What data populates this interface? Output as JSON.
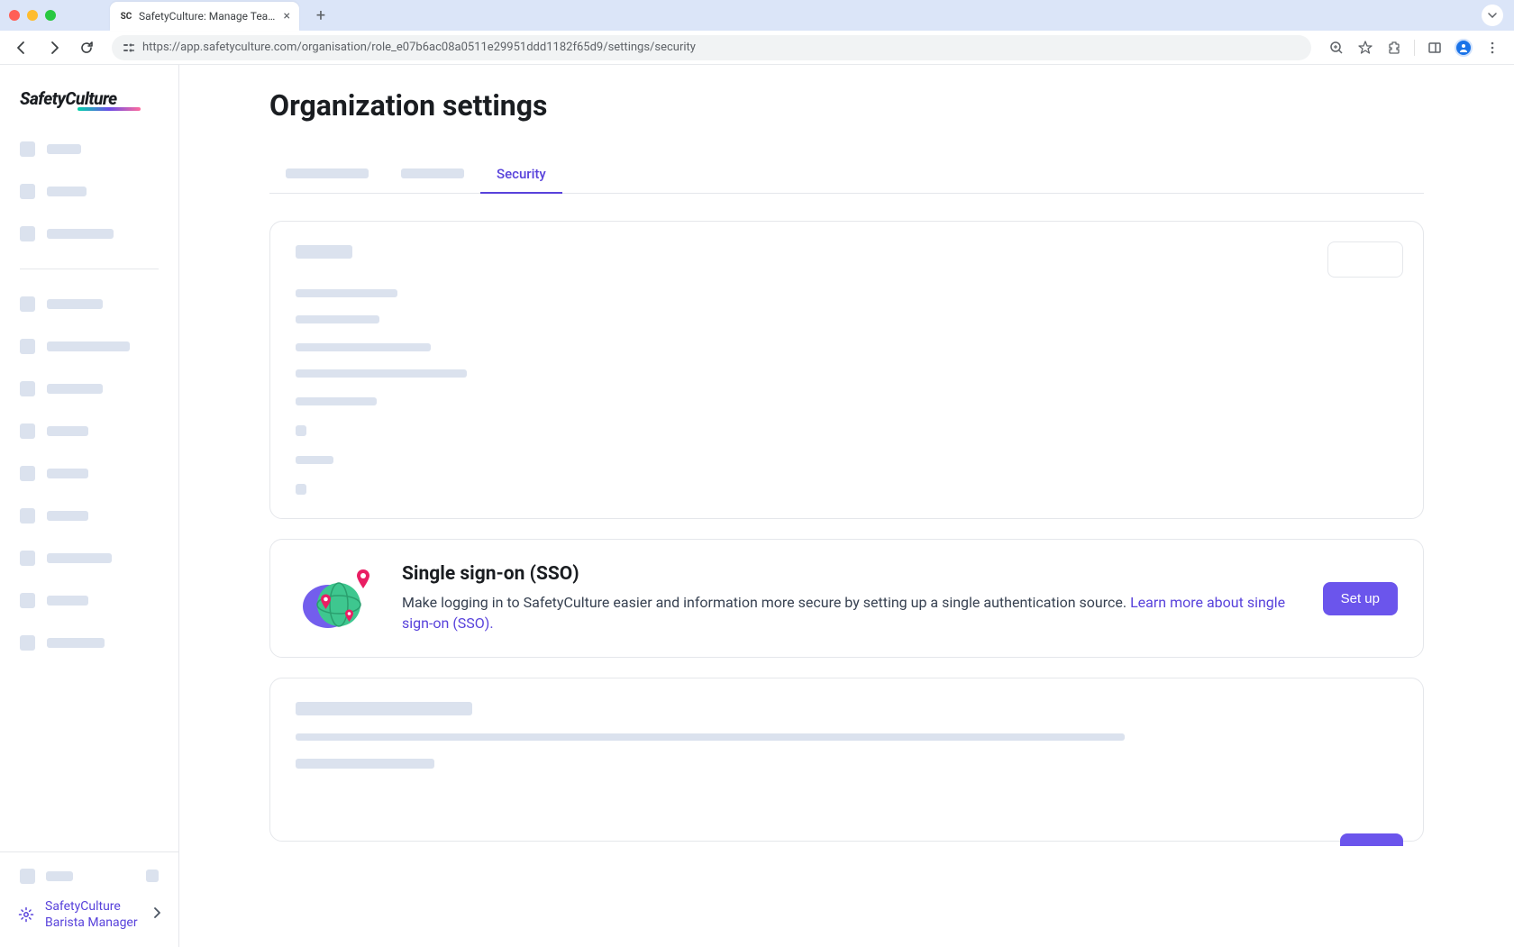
{
  "browser": {
    "tab_title": "SafetyCulture: Manage Teams and...",
    "url": "https://app.safetyculture.com/organisation/role_e07b6ac08a0511e29951ddd1182f65d9/settings/security"
  },
  "logo_text": "SafetyCulture",
  "page_title": "Organization settings",
  "tabs": {
    "active": "Security"
  },
  "sso": {
    "title": "Single sign-on (SSO)",
    "description": "Make logging in to SafetyCulture easier and information more secure by setting up a single authentication source. ",
    "link_text": "Learn more about single sign-on (SSO).",
    "button": "Set up"
  },
  "footer": {
    "org_line1": "SafetyCulture",
    "org_line2": "Barista Manager"
  }
}
